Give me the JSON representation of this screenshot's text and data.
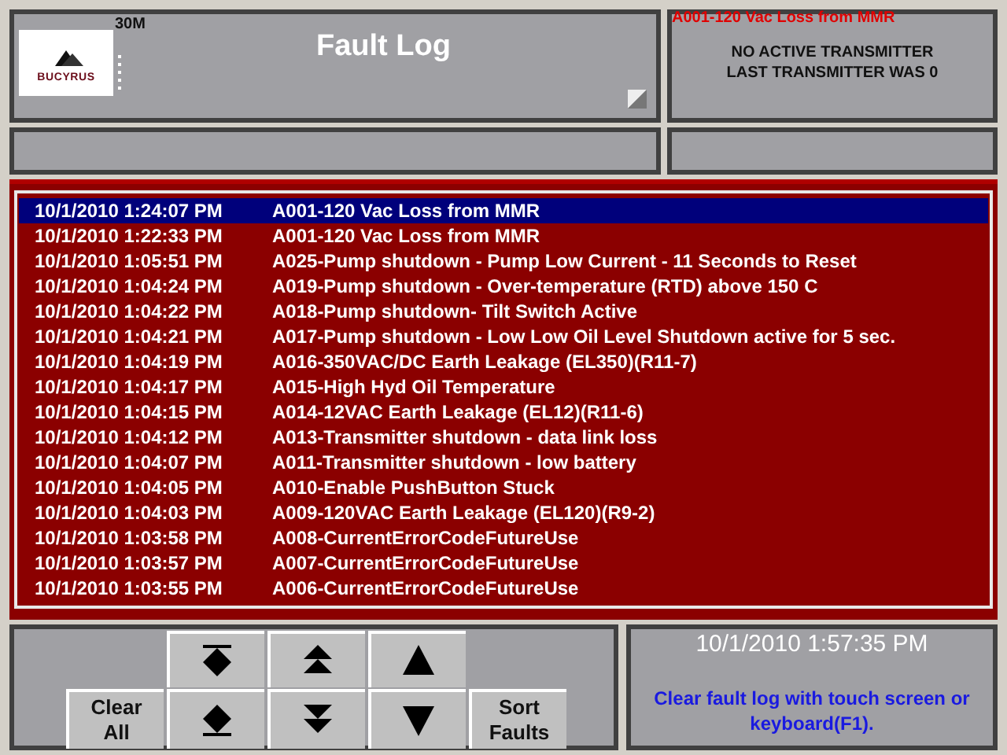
{
  "header": {
    "logo_text": "BUCYRUS",
    "unit": "30M",
    "title": "Fault Log"
  },
  "status": {
    "alarm": "A001-120 Vac Loss from MMR",
    "lines": [
      "NO ACTIVE TRANSMITTER",
      "LAST TRANSMITTER WAS 0"
    ]
  },
  "faults": [
    {
      "time": "10/1/2010 1:24:07 PM",
      "message": "A001-120 Vac Loss from MMR",
      "selected": true
    },
    {
      "time": "10/1/2010 1:22:33 PM",
      "message": "A001-120 Vac Loss from MMR",
      "selected": false
    },
    {
      "time": "10/1/2010 1:05:51 PM",
      "message": "A025-Pump shutdown - Pump Low Current - 11 Seconds to Reset",
      "selected": false
    },
    {
      "time": "10/1/2010 1:04:24 PM",
      "message": "A019-Pump shutdown - Over-temperature (RTD) above 150 C",
      "selected": false
    },
    {
      "time": "10/1/2010 1:04:22 PM",
      "message": "A018-Pump shutdown- Tilt Switch Active",
      "selected": false
    },
    {
      "time": "10/1/2010 1:04:21 PM",
      "message": "A017-Pump shutdown - Low Low Oil Level Shutdown active for 5 sec.",
      "selected": false
    },
    {
      "time": "10/1/2010 1:04:19 PM",
      "message": "A016-350VAC/DC Earth Leakage (EL350)(R11-7)",
      "selected": false
    },
    {
      "time": "10/1/2010 1:04:17 PM",
      "message": "A015-High Hyd Oil Temperature",
      "selected": false
    },
    {
      "time": "10/1/2010 1:04:15 PM",
      "message": "A014-12VAC Earth Leakage (EL12)(R11-6)",
      "selected": false
    },
    {
      "time": "10/1/2010 1:04:12 PM",
      "message": "A013-Transmitter shutdown - data link loss",
      "selected": false
    },
    {
      "time": "10/1/2010 1:04:07 PM",
      "message": "A011-Transmitter shutdown - low battery",
      "selected": false
    },
    {
      "time": "10/1/2010 1:04:05 PM",
      "message": "A010-Enable PushButton Stuck",
      "selected": false
    },
    {
      "time": "10/1/2010 1:04:03 PM",
      "message": "A009-120VAC Earth Leakage (EL120)(R9-2)",
      "selected": false
    },
    {
      "time": "10/1/2010 1:03:58 PM",
      "message": "A008-CurrentErrorCodeFutureUse",
      "selected": false
    },
    {
      "time": "10/1/2010 1:03:57 PM",
      "message": "A007-CurrentErrorCodeFutureUse",
      "selected": false
    },
    {
      "time": "10/1/2010 1:03:55 PM",
      "message": "A006-CurrentErrorCodeFutureUse",
      "selected": false
    }
  ],
  "controls": [
    {
      "kind": "top"
    },
    {
      "kind": "page-up"
    },
    {
      "kind": "up"
    },
    {
      "kind": "text",
      "label": [
        "Clear",
        "All"
      ]
    },
    {
      "kind": "bottom"
    },
    {
      "kind": "page-down"
    },
    {
      "kind": "down"
    },
    {
      "kind": "text",
      "label": [
        "Sort",
        "Faults"
      ]
    }
  ],
  "clock": "10/1/2010 1:57:35 PM",
  "hint": "Clear fault log with touch screen or keyboard(F1)."
}
